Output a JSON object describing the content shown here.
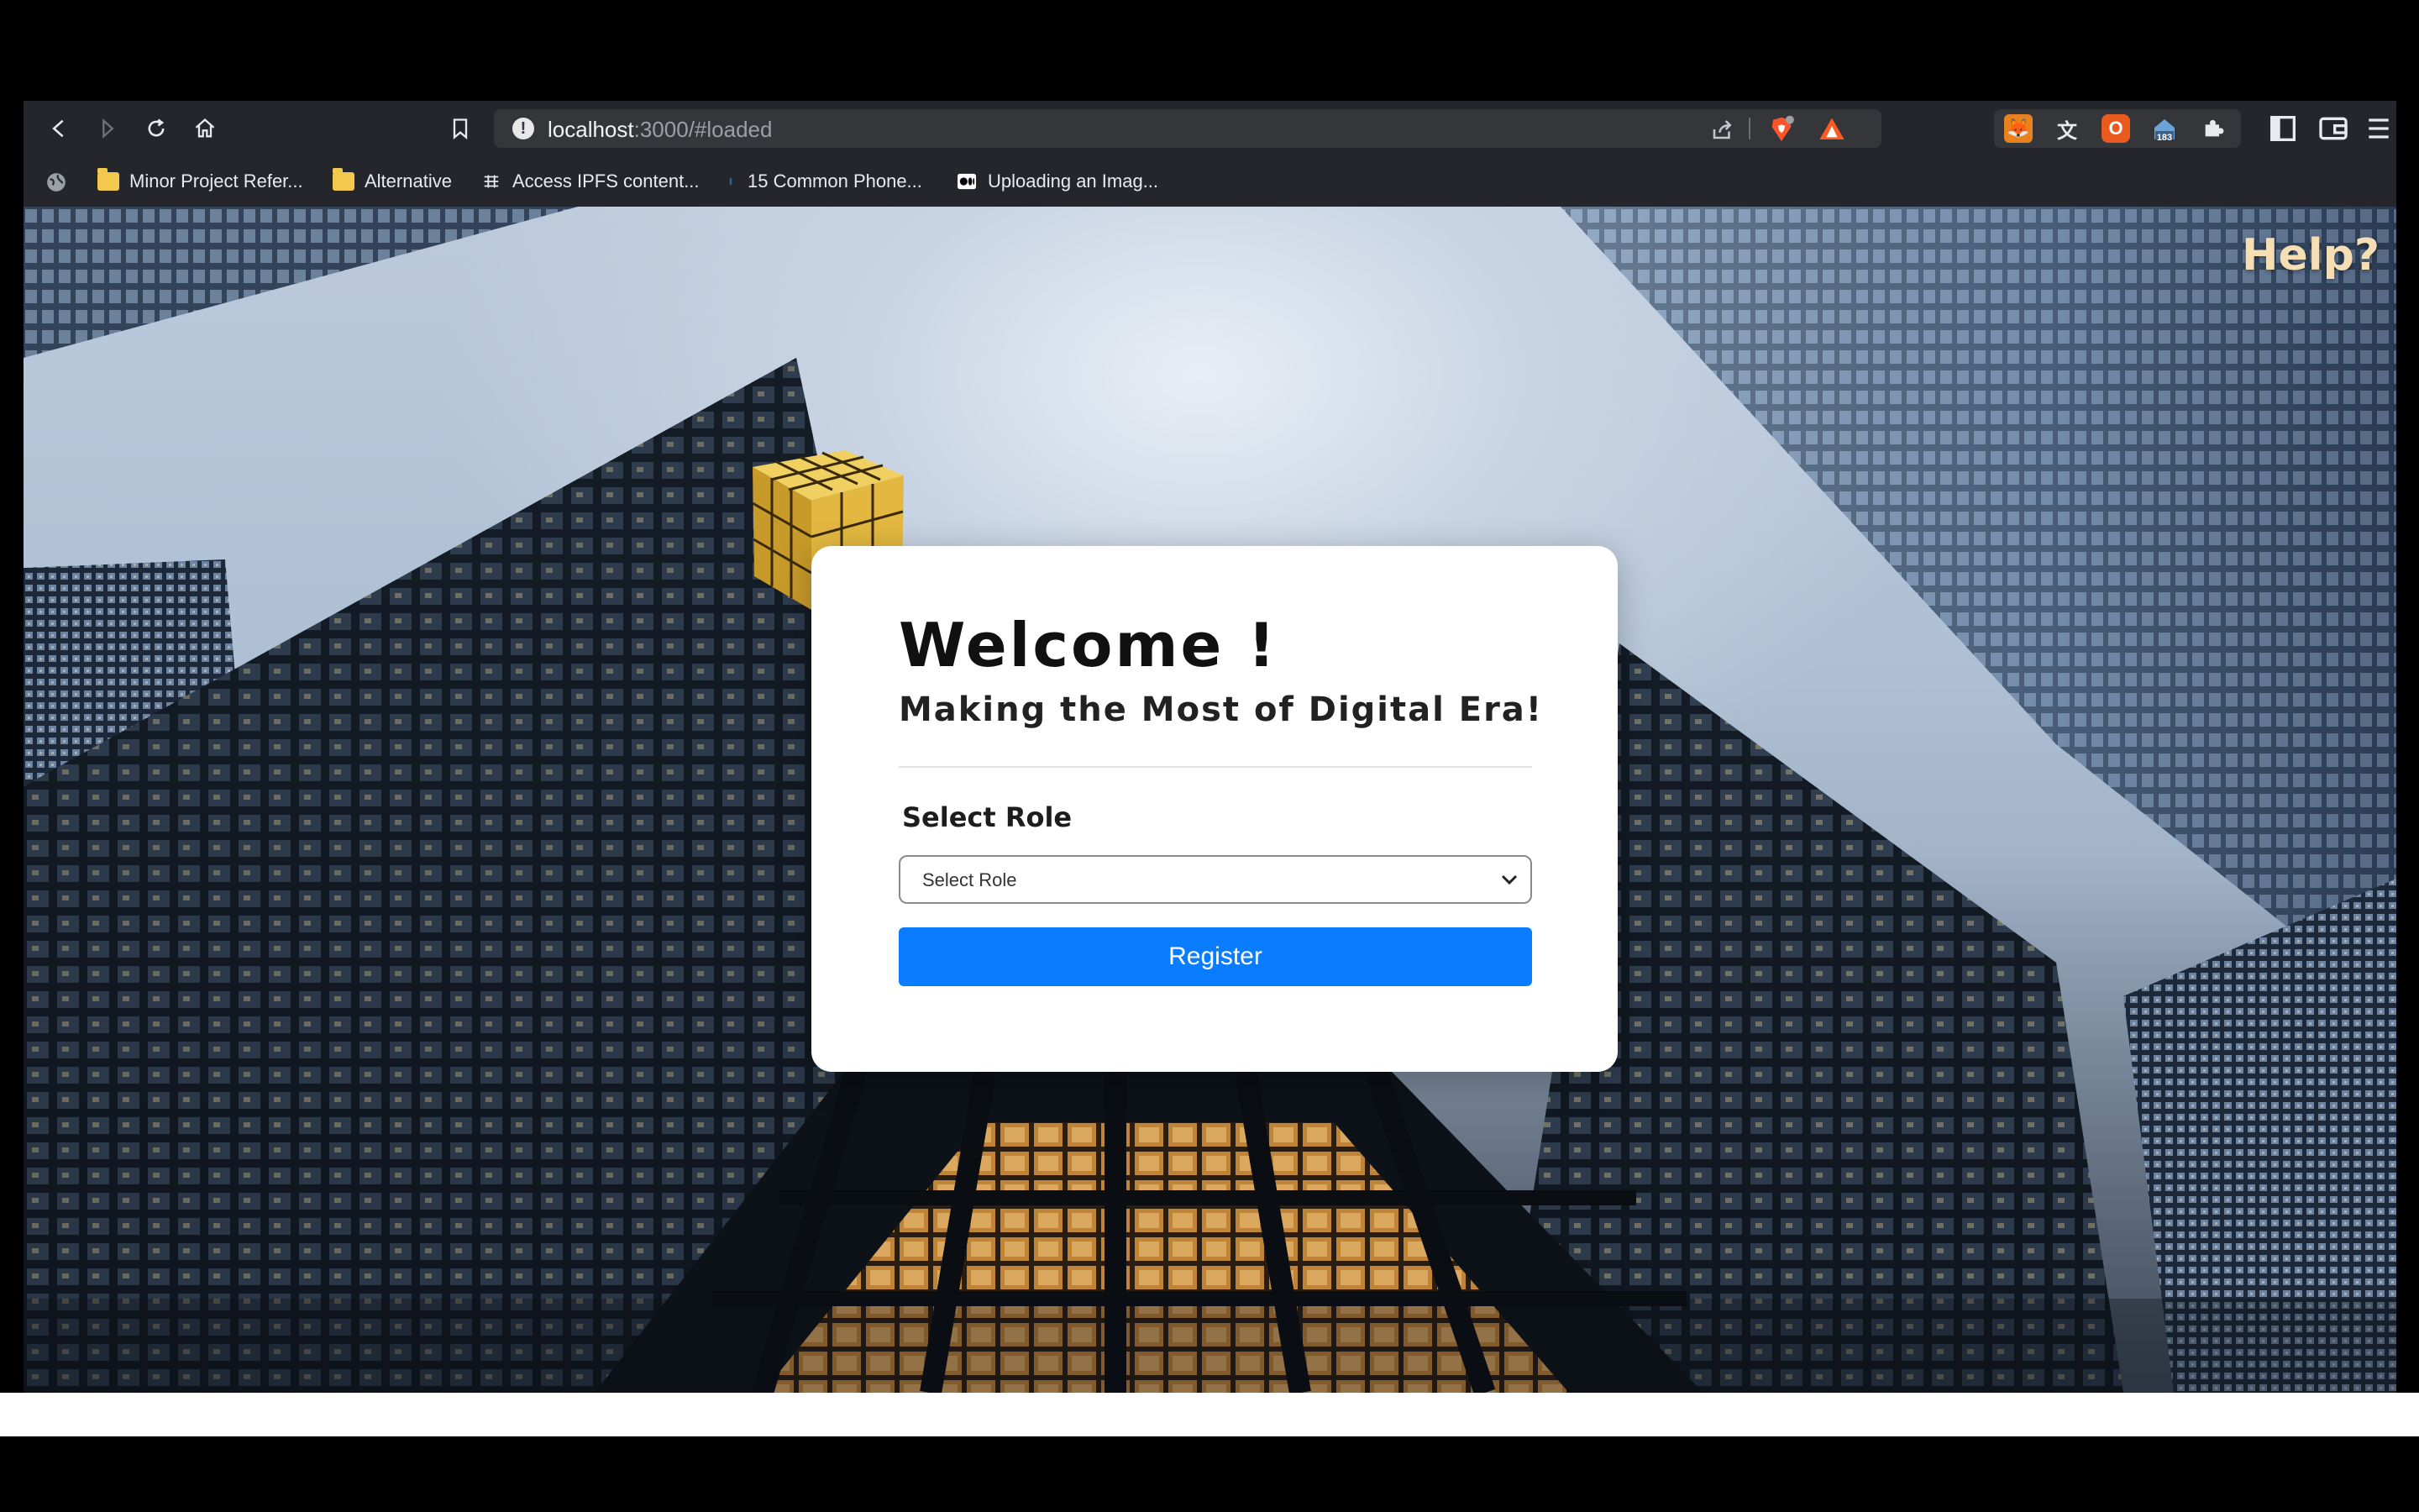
{
  "browser": {
    "url_host": "localhost",
    "url_path": ":3000/#loaded",
    "extension_badge": "183",
    "bookmarks": [
      {
        "label": "Minor Project Refer...",
        "icon": "folder-icon"
      },
      {
        "label": "Alternative",
        "icon": "folder-icon"
      },
      {
        "label": "Access IPFS content...",
        "icon": "ipfs-icon"
      },
      {
        "label": "15 Common Phone...",
        "icon": "bookmark-site-icon"
      },
      {
        "label": "Uploading an Imag...",
        "icon": "medium-icon"
      }
    ]
  },
  "page": {
    "help_link": "Help?",
    "welcome": "Welcome !",
    "tagline": "Making the Most of Digital Era!",
    "role_label": "Select Role",
    "role_select_value": "Select Role",
    "register_label": "Register"
  },
  "colors": {
    "primary_button": "#0a7cff",
    "help_text": "#f5deb3"
  }
}
